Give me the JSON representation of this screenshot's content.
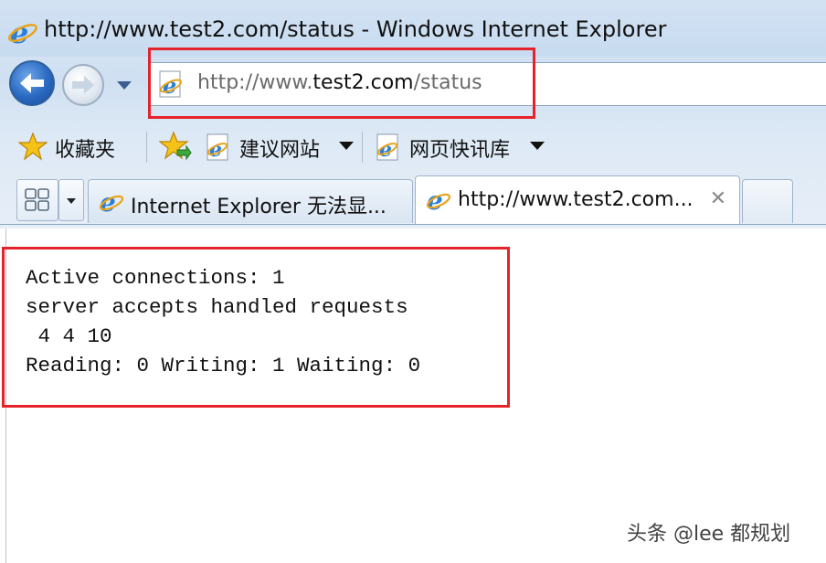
{
  "window": {
    "title": "http://www.test2.com/status - Windows Internet Explorer"
  },
  "address_bar": {
    "url_prefix": "http://www.",
    "url_domain": "test2.com",
    "url_path": "/status"
  },
  "favorites_bar": {
    "favorites_label": "收藏夹",
    "links": [
      {
        "label": "建议网站"
      },
      {
        "label": "网页快讯库"
      }
    ]
  },
  "tabs": [
    {
      "label": "Internet Explorer 无法显...",
      "active": false
    },
    {
      "label": "http://www.test2.com...",
      "active": true,
      "close": "✕"
    }
  ],
  "page_content": {
    "lines": [
      "Active connections: 1",
      "server accepts handled requests",
      " 4 4 10",
      "Reading: 0 Writing: 1 Waiting: 0"
    ]
  },
  "watermark": "头条 @lee 都规划",
  "colors": {
    "highlight_box": "#e5232a",
    "chrome_bg": "#d3e2f3"
  }
}
